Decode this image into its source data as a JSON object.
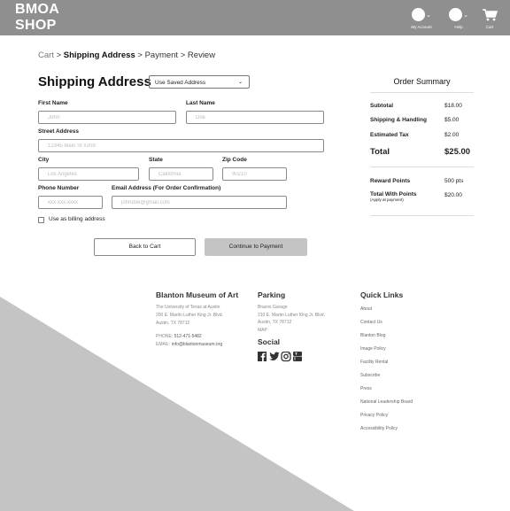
{
  "header": {
    "brand_line1": "BMOA",
    "brand_line2": "SHOP",
    "nav": [
      {
        "label": "My Account"
      },
      {
        "label": "Help"
      },
      {
        "label": "Cart"
      }
    ]
  },
  "breadcrumb": {
    "cart": "Cart",
    "sep1": ">",
    "shipping": "Shipping Address",
    "sep2": ">",
    "payment": "Payment",
    "sep3": ">",
    "review": "Review"
  },
  "form": {
    "title": "Shipping Address",
    "saved_select": "Use Saved Address",
    "first_name_label": "First Name",
    "first_name_placeholder": "John",
    "last_name_label": "Last Name",
    "last_name_placeholder": "Doe",
    "street_label": "Street Address",
    "street_placeholder": "12345 Main St #209",
    "city_label": "City",
    "city_placeholder": "Los Angeles",
    "state_label": "State",
    "state_placeholder": "California",
    "zip_label": "Zip Code",
    "zip_placeholder": "90210",
    "phone_label": "Phone Number",
    "phone_placeholder": "xxx-xxx-xxxx",
    "email_label": "Email Address (For Order Confirmation)",
    "email_placeholder": "johndoe@gmail.com",
    "billing_label": "Use as billing address",
    "back_button": "Back to Cart",
    "continue_button": "Continue to Payment"
  },
  "summary": {
    "title": "Order Summary",
    "subtotal_label": "Subtotal",
    "subtotal_value": "$18.00",
    "shipping_label": "Shipping & Handling",
    "shipping_value": "$5.00",
    "tax_label": "Estimated Tax",
    "tax_value": "$2.00",
    "total_label": "Total",
    "total_value": "$25.00",
    "reward_label": "Reward Points",
    "reward_value": "500 pts",
    "total_points_label": "Total With Points",
    "total_points_sub": "(Apply at payment)",
    "total_points_value": "$20.00"
  },
  "footer": {
    "museum_title": "Blanton Museum of Art",
    "museum_line1": "The University of Texas at Austin",
    "museum_line2": "200 E. Martin Luther King Jr. Blvd.",
    "museum_line3": "Austin, TX 78712",
    "phone_label": "PHONE:",
    "phone_value": "512-471-5482",
    "email_label": "EMAIL:",
    "email_value": "info@blantonmuseum.org",
    "parking_title": "Parking",
    "parking_line1": "Brazos Garage",
    "parking_line2": "210 E. Martin Luther King Jr. Blvd.",
    "parking_line3": "Austin, TX 78712",
    "parking_map": "MAP",
    "social_title": "Social",
    "quick_title": "Quick Links",
    "quick_links": [
      "About",
      "Contact Us",
      "Blanton Blog",
      "Image Policy",
      "Facility Rental",
      "Subscribe",
      "Press",
      "National Leadership Board",
      "Privacy Policy",
      "Accessibility Policy"
    ]
  },
  "colors": {
    "header_bg": "#8f8f8f",
    "button_primary": "#c4c4c4",
    "footer_triangle": "#c4c4c4"
  }
}
